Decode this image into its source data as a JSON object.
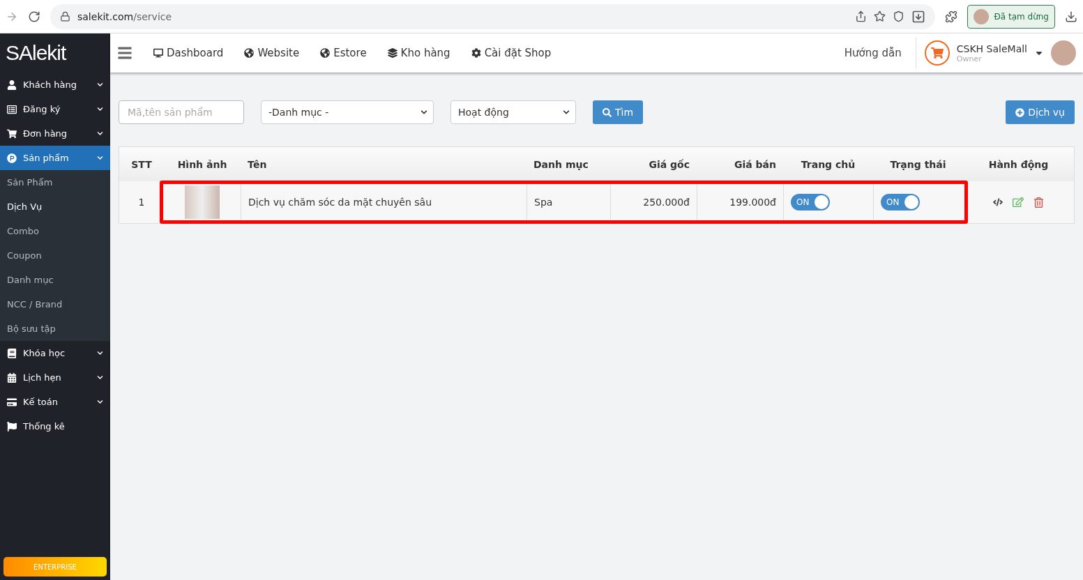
{
  "browser": {
    "url_host": "salekit.com",
    "url_path": "/service",
    "profile_label": "Đã tạm dừng"
  },
  "sidebar": {
    "logo": "SAlekit",
    "items": [
      {
        "label": "Khách hàng",
        "selected": false,
        "expandable": true
      },
      {
        "label": "Đăng ký",
        "selected": false,
        "expandable": true
      },
      {
        "label": "Đơn hàng",
        "selected": false,
        "expandable": true
      },
      {
        "label": "Sản phẩm",
        "selected": true,
        "expandable": true,
        "expanded": true,
        "children": [
          {
            "label": "Sản Phẩm",
            "selected": false
          },
          {
            "label": "Dịch Vụ",
            "selected": true
          },
          {
            "label": "Combo",
            "selected": false
          },
          {
            "label": "Coupon",
            "selected": false
          },
          {
            "label": "Danh mục",
            "selected": false
          },
          {
            "label": "NCC / Brand",
            "selected": false
          },
          {
            "label": "Bộ sưu tập",
            "selected": false
          }
        ]
      },
      {
        "label": "Khóa học",
        "selected": false,
        "expandable": true
      },
      {
        "label": "Lịch hẹn",
        "selected": false,
        "expandable": true
      },
      {
        "label": "Kế toán",
        "selected": false,
        "expandable": true
      },
      {
        "label": "Thống kê",
        "selected": false,
        "expandable": false
      }
    ],
    "plan_badge": "ENTERPRISE"
  },
  "topnav": {
    "items": [
      "Dashboard",
      "Website",
      "Estore",
      "Kho hàng",
      "Cài đặt Shop"
    ],
    "help": "Hướng dẫn",
    "shop_name": "CSKH SaleMall",
    "role": "Owner"
  },
  "filters": {
    "search": {
      "placeholder": "Mã,tên sản phẩm"
    },
    "category": "-Danh mục -",
    "status": "Hoạt động",
    "search_button": "Tìm",
    "add_button": "Dịch vụ"
  },
  "table": {
    "columns": [
      "STT",
      "Hình ảnh",
      "Tên",
      "Danh mục",
      "Giá gốc",
      "Giá bán",
      "Trang chủ",
      "Trạng thái",
      "Hành động"
    ],
    "rows": [
      {
        "stt": "1",
        "name": "Dịch vụ chăm sóc da mặt chuyên sâu",
        "category": "Spa",
        "price": "250.000đ",
        "sale_price": "199.000đ",
        "homepage": {
          "label": "ON",
          "on": true
        },
        "status": {
          "label": "ON",
          "on": true
        },
        "highlighted": true
      }
    ]
  }
}
